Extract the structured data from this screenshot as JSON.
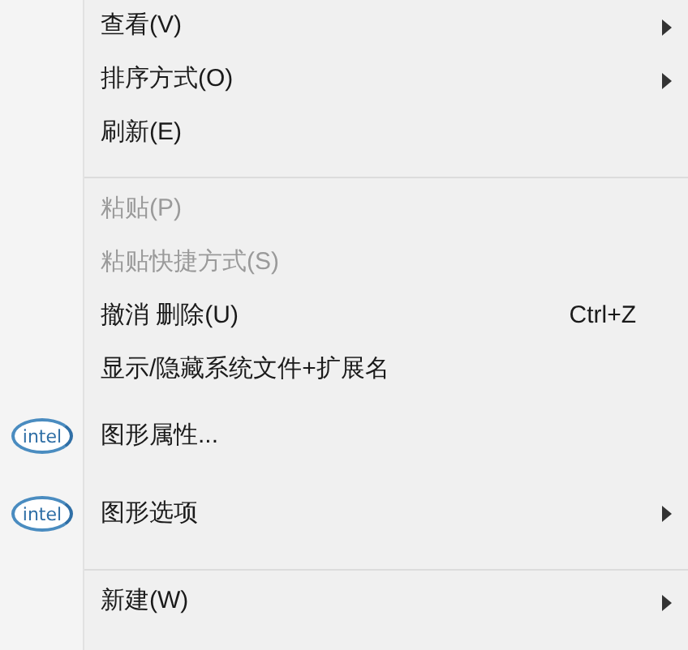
{
  "menu": [
    {
      "kind": "item",
      "label": "查看(V)",
      "disabled": false,
      "submenu": true
    },
    {
      "kind": "item",
      "label": "排序方式(O)",
      "disabled": false,
      "submenu": true
    },
    {
      "kind": "item",
      "label": "刷新(E)",
      "disabled": false,
      "submenu": false
    },
    {
      "kind": "separator"
    },
    {
      "kind": "item",
      "label": "粘贴(P)",
      "disabled": true,
      "submenu": false
    },
    {
      "kind": "item",
      "label": "粘贴快捷方式(S)",
      "disabled": true,
      "submenu": false
    },
    {
      "kind": "item",
      "label": "撤消 删除(U)",
      "disabled": false,
      "submenu": false,
      "shortcut": "Ctrl+Z"
    },
    {
      "kind": "item",
      "label": "显示/隐藏系统文件+扩展名",
      "disabled": false,
      "submenu": false
    },
    {
      "kind": "logo_item",
      "label": "图形属性...",
      "disabled": false,
      "submenu": false,
      "logo_text": "intel"
    },
    {
      "kind": "logo_item",
      "label": "图形选项",
      "disabled": false,
      "submenu": true,
      "logo_text": "intel"
    },
    {
      "kind": "separator"
    },
    {
      "kind": "item",
      "label": "新建(W)",
      "disabled": false,
      "submenu": true
    }
  ]
}
